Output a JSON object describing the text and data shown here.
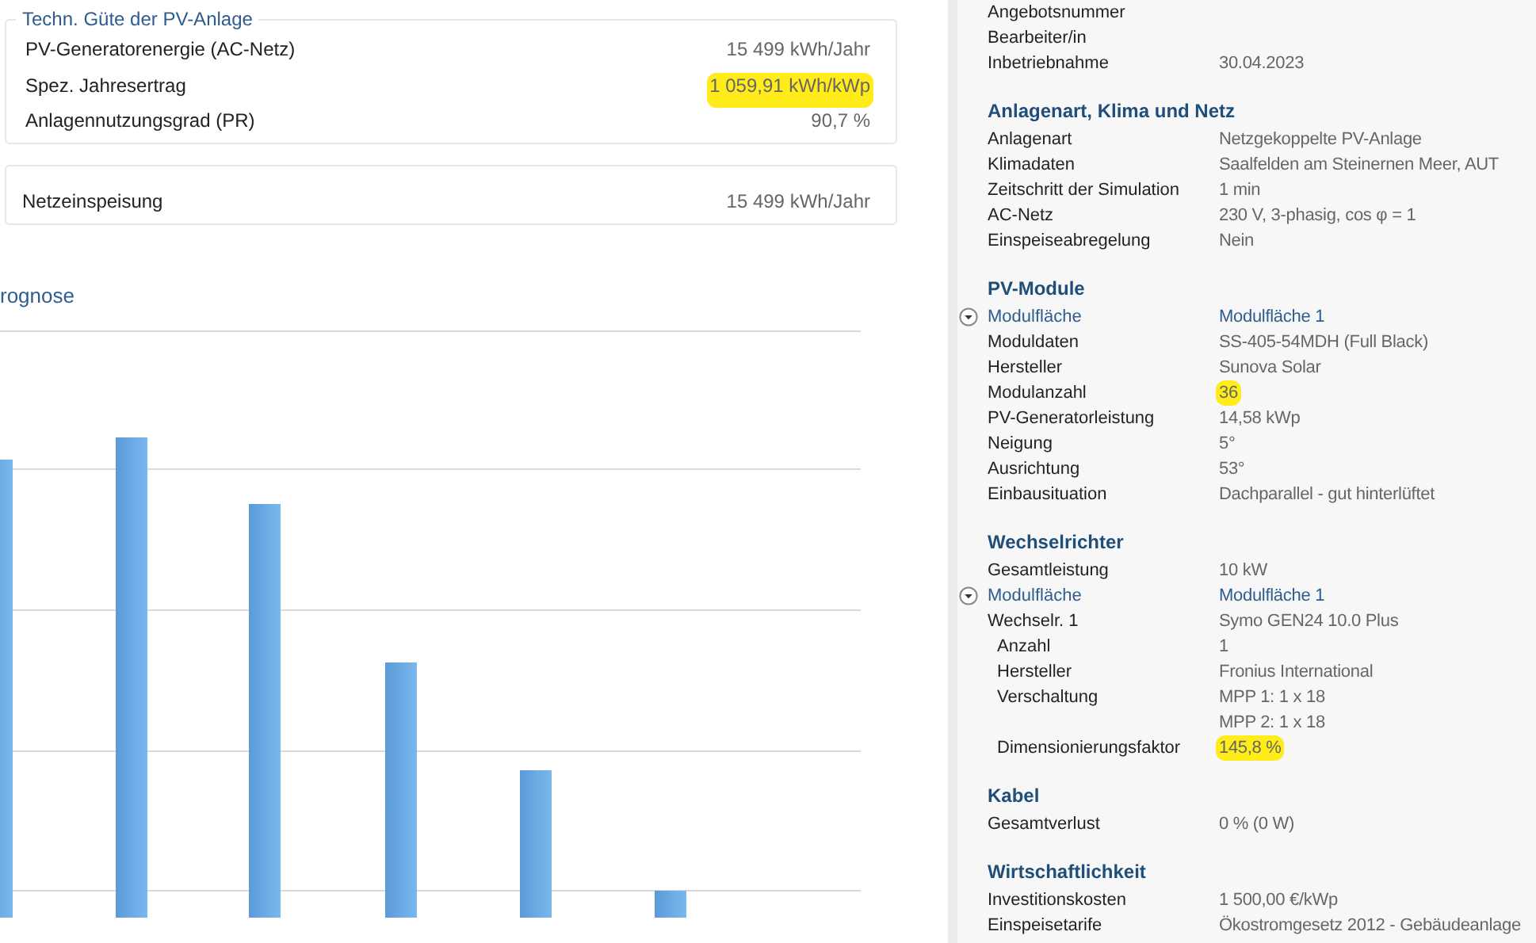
{
  "quality_group": {
    "title": "Techn. Güte der PV-Anlage",
    "rows": [
      {
        "label": "PV-Generatorenergie (AC-Netz)",
        "value": "15 499 kWh/Jahr",
        "highlighted": false
      },
      {
        "label": "Spez. Jahresertrag",
        "value": "1 059,91 kWh/kWp",
        "highlighted": true
      },
      {
        "label": "Anlagennutzungsgrad (PR)",
        "value": "90,7 %",
        "highlighted": false
      }
    ]
  },
  "feed_group": {
    "rows": [
      {
        "label": "Netzeinspeisung",
        "value": "15 499 kWh/Jahr",
        "highlighted": false
      }
    ]
  },
  "chart": {
    "title": "rognose"
  },
  "summary": {
    "sections": [
      {
        "rows": [
          {
            "kind": "plain",
            "label": "Angebotsnummer",
            "highlighted": false
          },
          {
            "kind": "plain",
            "label": "Bearbeiter/in",
            "highlighted": false
          },
          {
            "kind": "plain",
            "label": "Inbetriebnahme",
            "value": "30.04.2023",
            "highlighted": false
          }
        ]
      },
      {
        "title": "Anlagenart, Klima und Netz",
        "rows": [
          {
            "kind": "plain",
            "label": "Anlagenart",
            "value": "Netzgekoppelte PV-Anlage",
            "highlighted": false
          },
          {
            "kind": "plain",
            "label": "Klimadaten",
            "value": "Saalfelden am Steinernen Meer, AUT",
            "highlighted": false
          },
          {
            "kind": "plain",
            "label": "Zeitschritt der Simulation",
            "value": "1 min",
            "highlighted": false
          },
          {
            "kind": "plain",
            "label": "AC-Netz",
            "value": "230 V, 3-phasig, cos φ = 1",
            "highlighted": false
          },
          {
            "kind": "plain",
            "label": "Einspeiseabregelung",
            "value": "Nein",
            "highlighted": false
          }
        ]
      },
      {
        "title": "PV-Module",
        "rows": [
          {
            "kind": "link",
            "label": "Modulfläche",
            "value": "Modulfläche 1",
            "highlighted": false
          },
          {
            "kind": "plain",
            "label": "Moduldaten",
            "value": "SS-405-54MDH (Full Black)",
            "highlighted": false
          },
          {
            "kind": "plain",
            "label": "Hersteller",
            "value": "Sunova Solar",
            "highlighted": false
          },
          {
            "kind": "plain",
            "label": "Modulanzahl",
            "value": "36",
            "highlighted": true
          },
          {
            "kind": "plain",
            "label": "PV-Generatorleistung",
            "value": "14,58 kWp",
            "highlighted": false
          },
          {
            "kind": "plain",
            "label": "Neigung",
            "value": "5°",
            "highlighted": false
          },
          {
            "kind": "plain",
            "label": "Ausrichtung",
            "value": "53°",
            "highlighted": false
          },
          {
            "kind": "plain",
            "label": "Einbausituation",
            "value": "Dachparallel - gut hinterlüftet",
            "highlighted": false
          }
        ]
      },
      {
        "title": "Wechselrichter",
        "rows": [
          {
            "kind": "plain",
            "label": "Gesamtleistung",
            "value": "10 kW",
            "highlighted": false
          },
          {
            "kind": "link",
            "label": "Modulfläche",
            "value": "Modulfläche 1",
            "highlighted": false
          },
          {
            "kind": "plain",
            "label": "Wechselr. 1",
            "value": "Symo GEN24 10.0 Plus",
            "highlighted": false
          },
          {
            "kind": "sub",
            "label": "Anzahl",
            "value": "1",
            "highlighted": false
          },
          {
            "kind": "sub",
            "label": "Hersteller",
            "value": "Fronius International",
            "highlighted": false
          },
          {
            "kind": "sub",
            "label": "Verschaltung",
            "value": "MPP 1: 1 x 18",
            "highlighted": false
          },
          {
            "kind": "sub",
            "value": "MPP 2: 1 x 18",
            "highlighted": false
          },
          {
            "kind": "sub",
            "label": "Dimensionierungsfaktor",
            "value": "145,8 %",
            "highlighted": true
          }
        ]
      },
      {
        "title": "Kabel",
        "rows": [
          {
            "kind": "plain",
            "label": "Gesamtverlust",
            "value": "0 % (0 W)",
            "highlighted": false
          }
        ]
      },
      {
        "title": "Wirtschaftlichkeit",
        "rows": [
          {
            "kind": "plain",
            "label": "Investitionskosten",
            "value": "1 500,00 €/kWp",
            "highlighted": false
          },
          {
            "kind": "plain",
            "label": "Einspeisetarife",
            "value": "Ökostromgesetz 2012 - Gebäudeanlage",
            "highlighted": false
          }
        ]
      }
    ]
  }
}
